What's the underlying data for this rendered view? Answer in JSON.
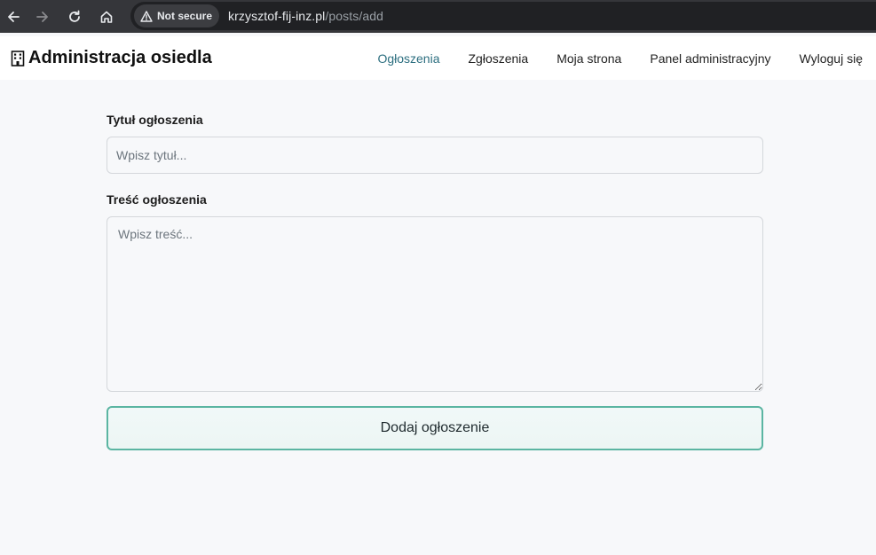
{
  "browser": {
    "security_label": "Not secure",
    "url_host": "krzysztof-fij-inz.pl",
    "url_path": "/posts/add",
    "icons": [
      "back-arrow-icon",
      "forward-arrow-icon",
      "reload-icon",
      "home-icon",
      "warning-triangle-icon"
    ]
  },
  "site": {
    "brand": "Administracja osiedla",
    "brand_icon": "building-icon",
    "nav": [
      {
        "label": "Ogłoszenia",
        "active": true
      },
      {
        "label": "Zgłoszenia",
        "active": false
      },
      {
        "label": "Moja strona",
        "active": false
      },
      {
        "label": "Panel administracyjny",
        "active": false
      },
      {
        "label": "Wyloguj się",
        "active": false
      }
    ]
  },
  "form": {
    "title_label": "Tytuł ogłoszenia",
    "title_placeholder": "Wpisz tytuł...",
    "title_value": "",
    "body_label": "Treść ogłoszenia",
    "body_placeholder": "Wpisz treść...",
    "body_value": "",
    "submit_label": "Dodaj ogłoszenie"
  },
  "colors": {
    "accent": "#2d6f80",
    "button_border": "#5bb5a2",
    "page_bg": "#f7f8fa"
  }
}
